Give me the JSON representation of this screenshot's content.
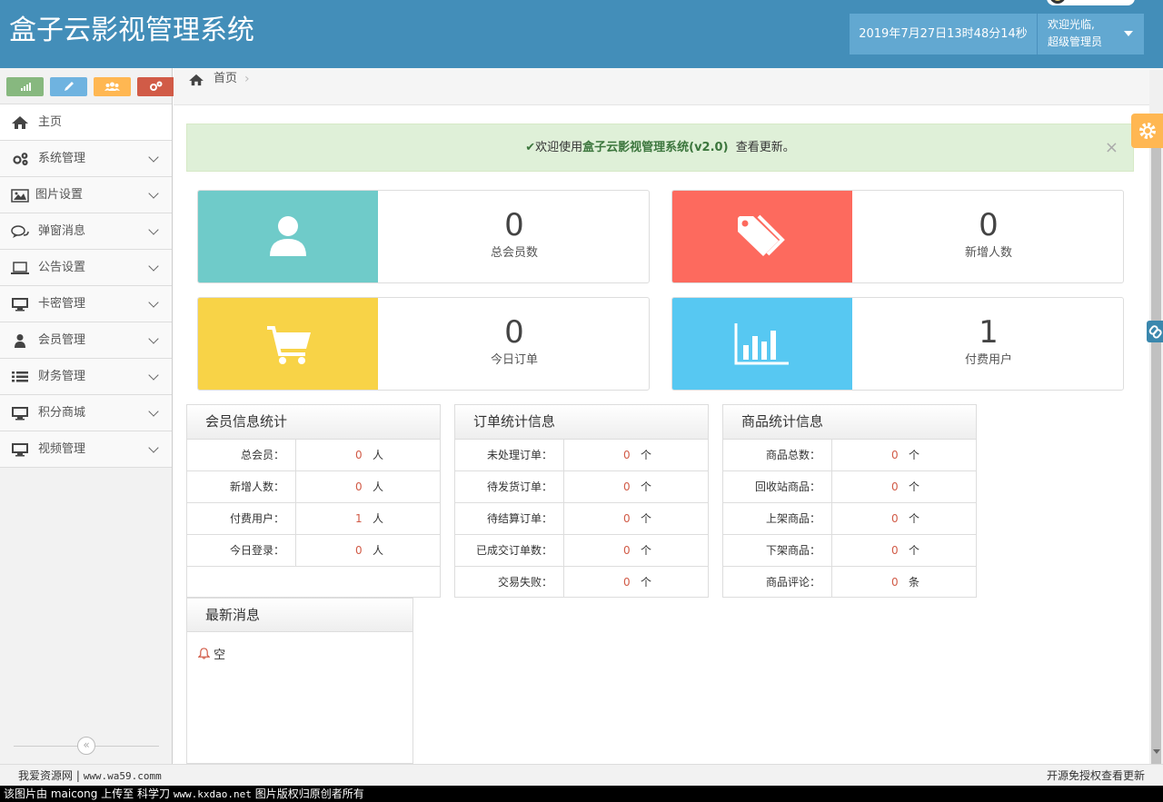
{
  "header": {
    "title": "盒子云影视管理系统",
    "datetime": "2019年7月27日13时48分14秒",
    "welcome": "欢迎光临,",
    "role": "超级管理员"
  },
  "breadcrumb": {
    "home": "首页",
    "sep": "›"
  },
  "sidebar": {
    "shortcuts": [
      {
        "icon": "signal-icon",
        "color": "#87b87f"
      },
      {
        "icon": "pencil-icon",
        "color": "#6fb3e0"
      },
      {
        "icon": "users-icon",
        "color": "#ffb752"
      },
      {
        "icon": "cogs-icon",
        "color": "#d15b47"
      }
    ],
    "items": [
      {
        "label": "主页",
        "icon": "home-icon"
      },
      {
        "label": "系统管理",
        "icon": "cogs-icon"
      },
      {
        "label": "图片设置",
        "icon": "picture-icon"
      },
      {
        "label": "弹窗消息",
        "icon": "comments-icon"
      },
      {
        "label": "公告设置",
        "icon": "laptop-icon"
      },
      {
        "label": "卡密管理",
        "icon": "desktop-icon"
      },
      {
        "label": "会员管理",
        "icon": "user-icon"
      },
      {
        "label": "财务管理",
        "icon": "list-icon"
      },
      {
        "label": "积分商城",
        "icon": "desktop-icon"
      },
      {
        "label": "视频管理",
        "icon": "desktop-icon"
      }
    ],
    "collapse": "«"
  },
  "alert": {
    "prefix": "欢迎使用",
    "system": "盒子云影视管理系统(v2.0)",
    "suffix": "查看更新。",
    "close": "×"
  },
  "cards": [
    {
      "value": "0",
      "label": "总会员数",
      "color": "#6fcbc9",
      "icon": "user-icon"
    },
    {
      "value": "0",
      "label": "新增人数",
      "color": "#fd6a5e",
      "icon": "tags-icon"
    },
    {
      "value": "0",
      "label": "今日订单",
      "color": "#f8d347",
      "icon": "cart-icon"
    },
    {
      "value": "1",
      "label": "付费用户",
      "color": "#57c8f2",
      "icon": "bar-chart-icon"
    }
  ],
  "member_stats": {
    "title": "会员信息统计",
    "rows": [
      {
        "k": "总会员：",
        "v": "0",
        "u": "人"
      },
      {
        "k": "新增人数：",
        "v": "0",
        "u": "人"
      },
      {
        "k": "付费用户：",
        "v": "1",
        "u": "人"
      },
      {
        "k": "今日登录：",
        "v": "0",
        "u": "人"
      }
    ]
  },
  "order_stats": {
    "title": "订单统计信息",
    "rows": [
      {
        "k": "未处理订单：",
        "v": "0",
        "u": "个"
      },
      {
        "k": "待发货订单：",
        "v": "0",
        "u": "个"
      },
      {
        "k": "待结算订单：",
        "v": "0",
        "u": "个"
      },
      {
        "k": "已成交订单数：",
        "v": "0",
        "u": "个"
      },
      {
        "k": "交易失败：",
        "v": "0",
        "u": "个"
      }
    ]
  },
  "product_stats": {
    "title": "商品统计信息",
    "rows": [
      {
        "k": "商品总数：",
        "v": "0",
        "u": "个"
      },
      {
        "k": "回收站商品：",
        "v": "0",
        "u": "个"
      },
      {
        "k": "上架商品：",
        "v": "0",
        "u": "个"
      },
      {
        "k": "下架商品：",
        "v": "0",
        "u": "个"
      },
      {
        "k": "商品评论：",
        "v": "0",
        "u": "条"
      }
    ]
  },
  "news": {
    "title": "最新消息",
    "empty": "空"
  },
  "footer": {
    "left_text": "我爱资源网 |",
    "left_url": "www.wa59.comm",
    "right": "开源免授权查看更新"
  },
  "watermark": {
    "part1": "该图片由 maicong 上传至 科学刀",
    "url": "www.kxdao.net",
    "part2": "图片版权归原创者所有"
  }
}
